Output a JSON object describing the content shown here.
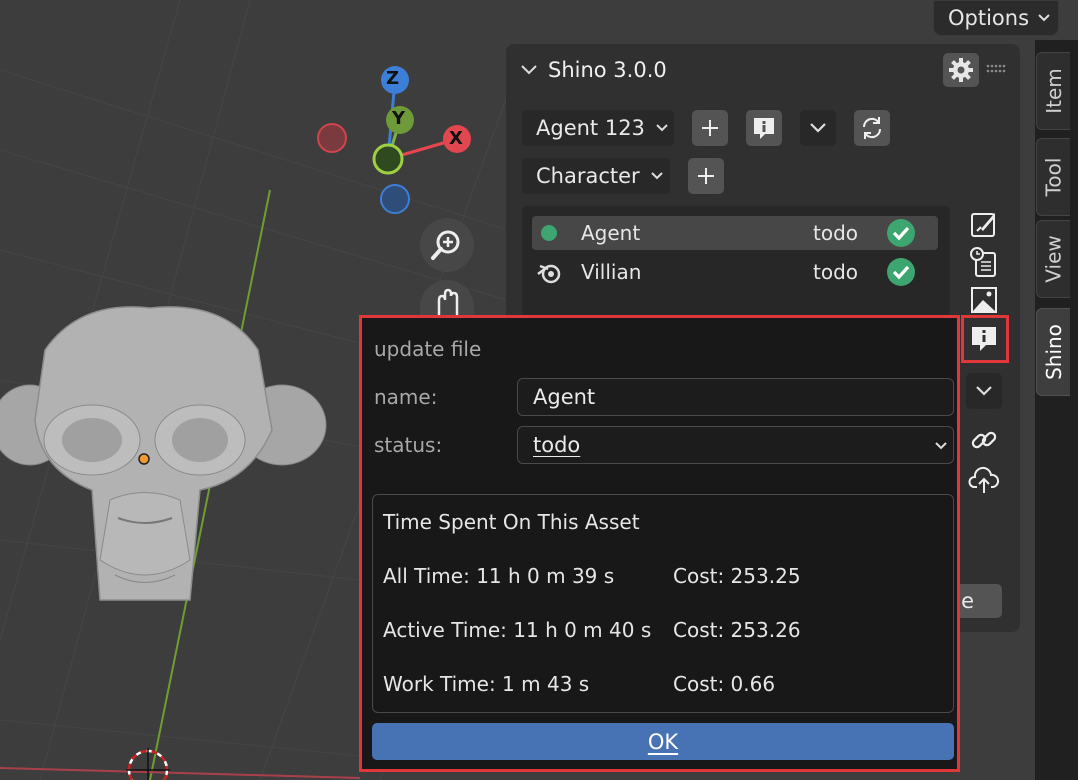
{
  "header": {
    "options_label": "Options"
  },
  "side_tabs": [
    {
      "label": "Item"
    },
    {
      "label": "Tool"
    },
    {
      "label": "View"
    },
    {
      "label": "Shino"
    }
  ],
  "navigation_gizmo": {
    "z": "Z",
    "y": "Y",
    "x": "X"
  },
  "panel": {
    "title": "Shino 3.0.0",
    "agent_dropdown": "Agent 123",
    "character_dropdown": "Character",
    "list": [
      {
        "name": "Agent",
        "status": "todo"
      },
      {
        "name": "Villian",
        "status": "todo"
      }
    ],
    "partial_button_text": "e"
  },
  "popup": {
    "title": "update file",
    "name_label": "name:",
    "name_value": "Agent",
    "status_label": "status:",
    "status_value": "todo",
    "time_section": {
      "heading": "Time Spent On This Asset",
      "rows": [
        {
          "label": "All Time: 11 h 0 m 39 s",
          "cost": "Cost: 253.25"
        },
        {
          "label": "Active Time: 11 h 0 m 40 s",
          "cost": "Cost: 253.26"
        },
        {
          "label": "Work Time: 1 m 43 s",
          "cost": "Cost: 0.66"
        }
      ]
    },
    "ok_label": "OK"
  },
  "colors": {
    "accent_blue": "#4772b3",
    "highlight_red": "#e0383a",
    "status_green": "#3da56f",
    "axis_x": "#e8464f",
    "axis_y": "#7fb04a",
    "axis_z": "#3d7fd6"
  }
}
